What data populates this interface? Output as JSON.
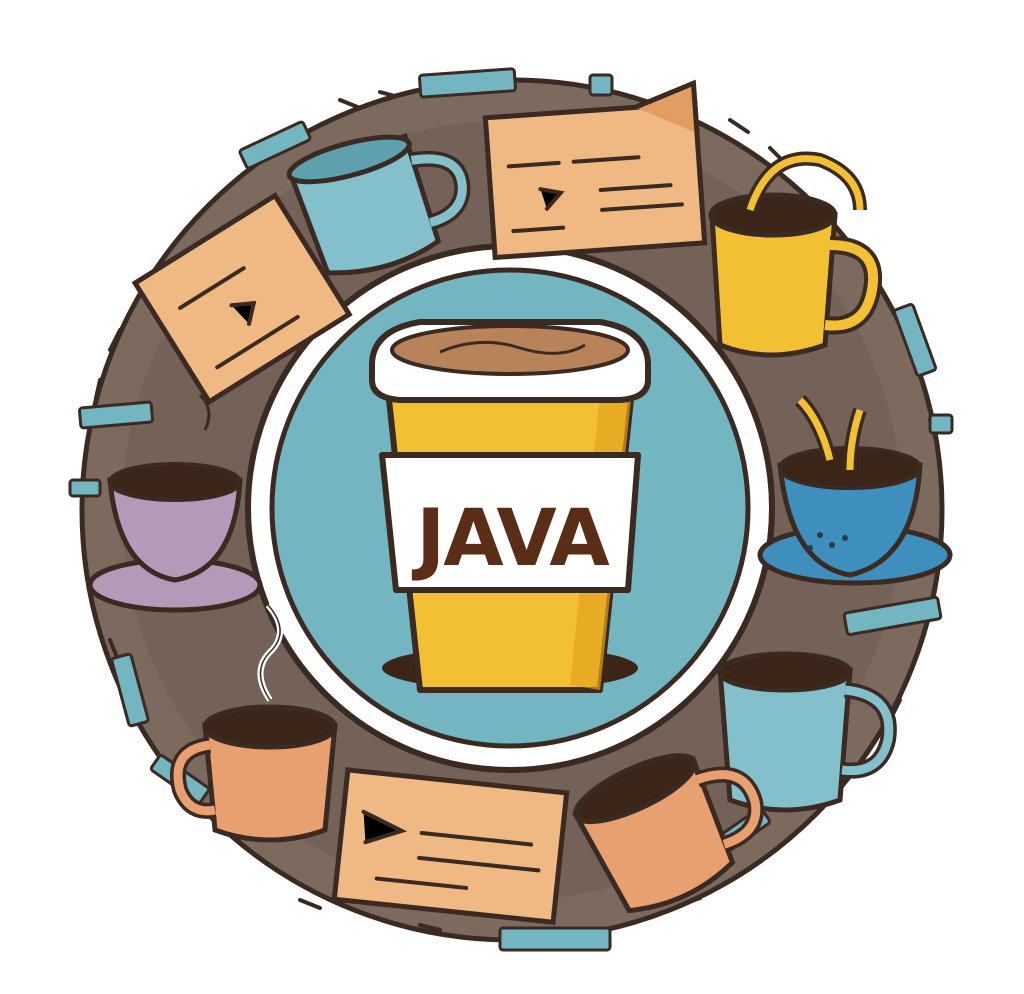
{
  "illustration": {
    "label": "JAVA"
  },
  "colors": {
    "outline": "#3a2a22",
    "ring": "#7d6a5f",
    "ring_dark": "#5e4c43",
    "teal": "#73b6c2",
    "teal_light": "#8fc8d2",
    "yellow": "#f3bf33",
    "yellow_dark": "#e2a21e",
    "coffee": "#3b2418",
    "foam": "#b8835a",
    "paper": "#f0b882",
    "paper_dark": "#e29d62",
    "mug_blue": "#84c0cc",
    "mug_purple": "#b49ab8",
    "mug_orange": "#e9a070",
    "cup_blue": "#3e8fbd",
    "white": "#ffffff"
  },
  "icons": [
    "coffee-cup-icon",
    "blue-mug-icon",
    "yellow-mug-icon",
    "pouring-cup-icon",
    "purple-teacup-icon",
    "orange-mug-icon",
    "light-blue-mug-icon",
    "tipped-mug-icon",
    "code-card-icon"
  ]
}
